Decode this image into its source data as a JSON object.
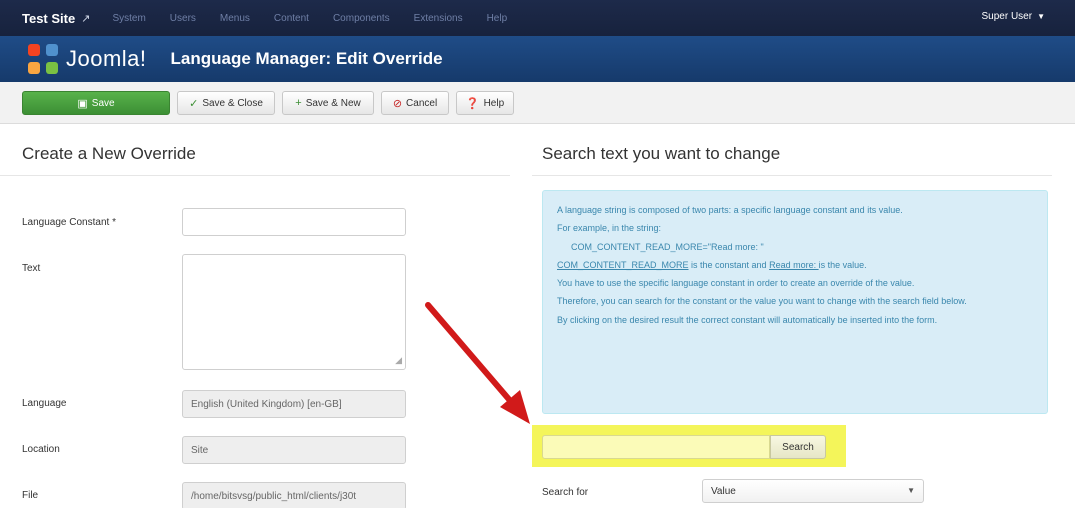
{
  "topbar": {
    "site_name": "Test Site",
    "ext_icon": "external-link-icon",
    "menu": [
      "System",
      "Users",
      "Menus",
      "Content",
      "Components",
      "Extensions",
      "Help"
    ],
    "user": "Super User"
  },
  "header": {
    "logo_text": "Joomla!",
    "title": "Language Manager: Edit Override"
  },
  "toolbar": {
    "save": "Save",
    "save_close": "Save & Close",
    "save_new": "Save & New",
    "cancel": "Cancel",
    "help": "Help"
  },
  "left": {
    "heading": "Create a New Override",
    "language_constant_label": "Language Constant *",
    "language_constant_value": "",
    "text_label": "Text",
    "text_value": "",
    "language_label": "Language",
    "language_value": "English (United Kingdom) [en-GB]",
    "location_label": "Location",
    "location_value": "Site",
    "file_label": "File",
    "file_value": "/home/bitsvsg/public_html/clients/j30t"
  },
  "right": {
    "heading": "Search text you want to change",
    "info": {
      "line1": "A language string is composed of two parts: a specific language constant and its value.",
      "line2": "For example, in the string:",
      "line3": "COM_CONTENT_READ_MORE=\"Read more: \"",
      "line4_a": "COM_CONTENT_READ_MORE",
      "line4_b": " is the constant and ",
      "line4_c": "Read more: ",
      "line4_d": " is the value.",
      "line5": "You have to use the specific language constant in order to create an override of the value.",
      "line6": "Therefore, you can search for the constant or the value you want to change with the search field below.",
      "line7": "By clicking on the desired result the correct constant will automatically be inserted into the form."
    },
    "search_value": "",
    "search_button": "Search",
    "search_for_label": "Search for",
    "search_for_value": "Value"
  },
  "colors": {
    "topbar": "#1d2a4a",
    "header": "#1f4c87",
    "save_green": "#4aa23f",
    "info_bg": "#d9edf7",
    "highlight": "#f4f55a",
    "arrow": "#d11a1a"
  }
}
